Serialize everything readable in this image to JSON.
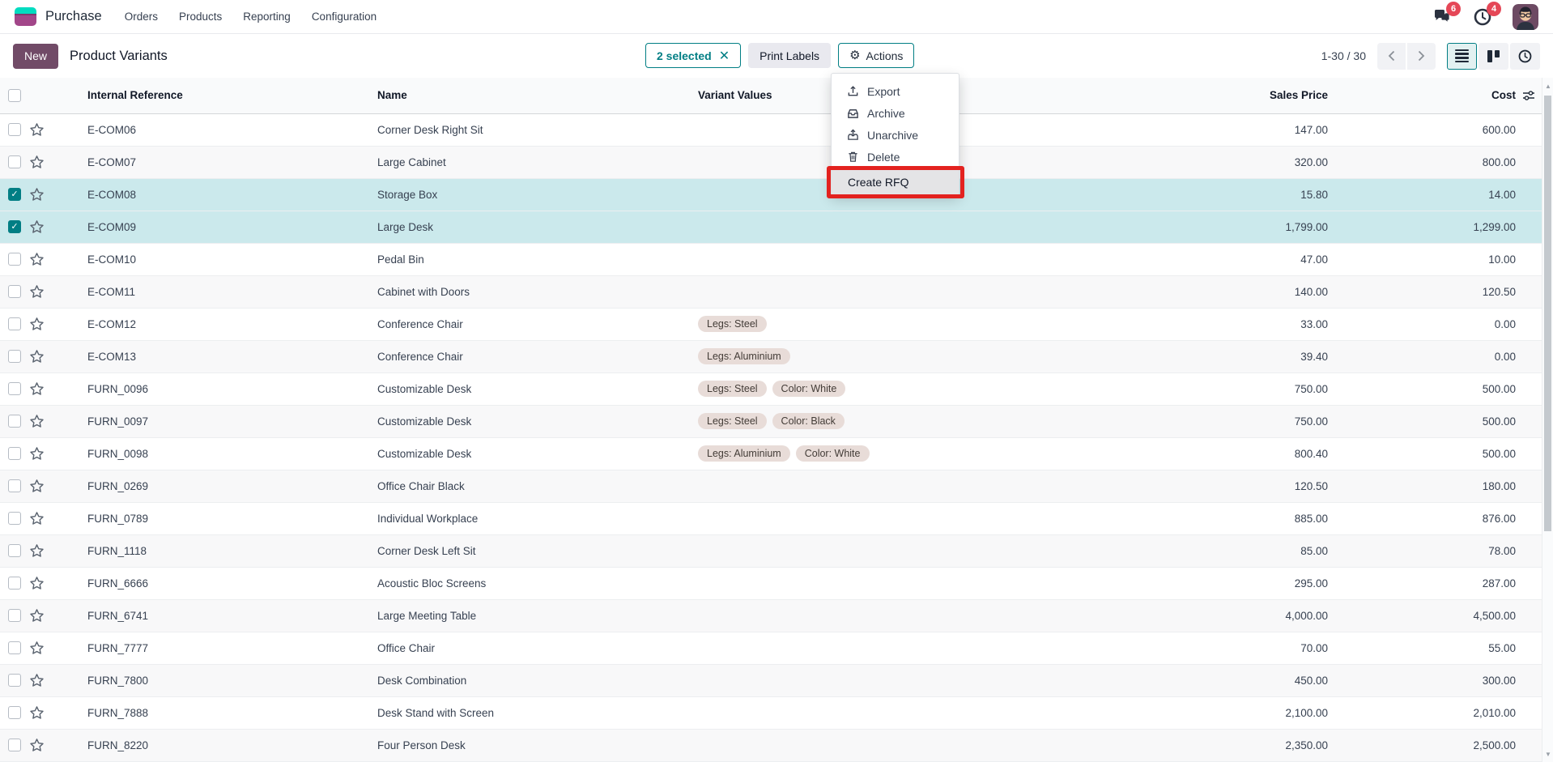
{
  "navbar": {
    "app_name": "Purchase",
    "menus": [
      "Orders",
      "Products",
      "Reporting",
      "Configuration"
    ],
    "message_badge": "6",
    "activity_badge": "4"
  },
  "control_panel": {
    "new_label": "New",
    "title": "Product Variants",
    "selected_badge": "2 selected",
    "print_labels_label": "Print Labels",
    "actions_label": "Actions",
    "pager": "1-30 / 30"
  },
  "actions_menu": {
    "items": [
      {
        "label": "Export",
        "icon": "export-icon",
        "highlighted": false
      },
      {
        "label": "Archive",
        "icon": "archive-icon",
        "highlighted": false
      },
      {
        "label": "Unarchive",
        "icon": "unarchive-icon",
        "highlighted": false
      },
      {
        "label": "Delete",
        "icon": "delete-icon",
        "highlighted": false
      },
      {
        "label": "Create RFQ",
        "icon": null,
        "highlighted": true
      }
    ]
  },
  "table": {
    "columns": [
      "Internal Reference",
      "Name",
      "Variant Values",
      "Sales Price",
      "Cost"
    ],
    "rows": [
      {
        "ref": "E-COM06",
        "name": "Corner Desk Right Sit",
        "variants": [],
        "sales_price": "147.00",
        "cost": "600.00",
        "selected": false
      },
      {
        "ref": "E-COM07",
        "name": "Large Cabinet",
        "variants": [],
        "sales_price": "320.00",
        "cost": "800.00",
        "selected": false
      },
      {
        "ref": "E-COM08",
        "name": "Storage Box",
        "variants": [],
        "sales_price": "15.80",
        "cost": "14.00",
        "selected": true
      },
      {
        "ref": "E-COM09",
        "name": "Large Desk",
        "variants": [],
        "sales_price": "1,799.00",
        "cost": "1,299.00",
        "selected": true
      },
      {
        "ref": "E-COM10",
        "name": "Pedal Bin",
        "variants": [],
        "sales_price": "47.00",
        "cost": "10.00",
        "selected": false
      },
      {
        "ref": "E-COM11",
        "name": "Cabinet with Doors",
        "variants": [],
        "sales_price": "140.00",
        "cost": "120.50",
        "selected": false
      },
      {
        "ref": "E-COM12",
        "name": "Conference Chair",
        "variants": [
          "Legs: Steel"
        ],
        "sales_price": "33.00",
        "cost": "0.00",
        "selected": false
      },
      {
        "ref": "E-COM13",
        "name": "Conference Chair",
        "variants": [
          "Legs: Aluminium"
        ],
        "sales_price": "39.40",
        "cost": "0.00",
        "selected": false
      },
      {
        "ref": "FURN_0096",
        "name": "Customizable Desk",
        "variants": [
          "Legs: Steel",
          "Color: White"
        ],
        "sales_price": "750.00",
        "cost": "500.00",
        "selected": false
      },
      {
        "ref": "FURN_0097",
        "name": "Customizable Desk",
        "variants": [
          "Legs: Steel",
          "Color: Black"
        ],
        "sales_price": "750.00",
        "cost": "500.00",
        "selected": false
      },
      {
        "ref": "FURN_0098",
        "name": "Customizable Desk",
        "variants": [
          "Legs: Aluminium",
          "Color: White"
        ],
        "sales_price": "800.40",
        "cost": "500.00",
        "selected": false
      },
      {
        "ref": "FURN_0269",
        "name": "Office Chair Black",
        "variants": [],
        "sales_price": "120.50",
        "cost": "180.00",
        "selected": false
      },
      {
        "ref": "FURN_0789",
        "name": "Individual Workplace",
        "variants": [],
        "sales_price": "885.00",
        "cost": "876.00",
        "selected": false
      },
      {
        "ref": "FURN_1118",
        "name": "Corner Desk Left Sit",
        "variants": [],
        "sales_price": "85.00",
        "cost": "78.00",
        "selected": false
      },
      {
        "ref": "FURN_6666",
        "name": "Acoustic Bloc Screens",
        "variants": [],
        "sales_price": "295.00",
        "cost": "287.00",
        "selected": false
      },
      {
        "ref": "FURN_6741",
        "name": "Large Meeting Table",
        "variants": [],
        "sales_price": "4,000.00",
        "cost": "4,500.00",
        "selected": false
      },
      {
        "ref": "FURN_7777",
        "name": "Office Chair",
        "variants": [],
        "sales_price": "70.00",
        "cost": "55.00",
        "selected": false
      },
      {
        "ref": "FURN_7800",
        "name": "Desk Combination",
        "variants": [],
        "sales_price": "450.00",
        "cost": "300.00",
        "selected": false
      },
      {
        "ref": "FURN_7888",
        "name": "Desk Stand with Screen",
        "variants": [],
        "sales_price": "2,100.00",
        "cost": "2,010.00",
        "selected": false
      },
      {
        "ref": "FURN_8220",
        "name": "Four Person Desk",
        "variants": [],
        "sales_price": "2,350.00",
        "cost": "2,500.00",
        "selected": false
      }
    ]
  },
  "colors": {
    "accent_teal": "#017e84",
    "primary_purple": "#714b67",
    "selected_row_bg": "#cbe9ec",
    "highlight_red": "#e3221f",
    "badge_red": "#e54757",
    "tag_bg": "#e8dcd8",
    "logo_teal": "#00dcc0",
    "logo_magenta": "#a24689"
  }
}
